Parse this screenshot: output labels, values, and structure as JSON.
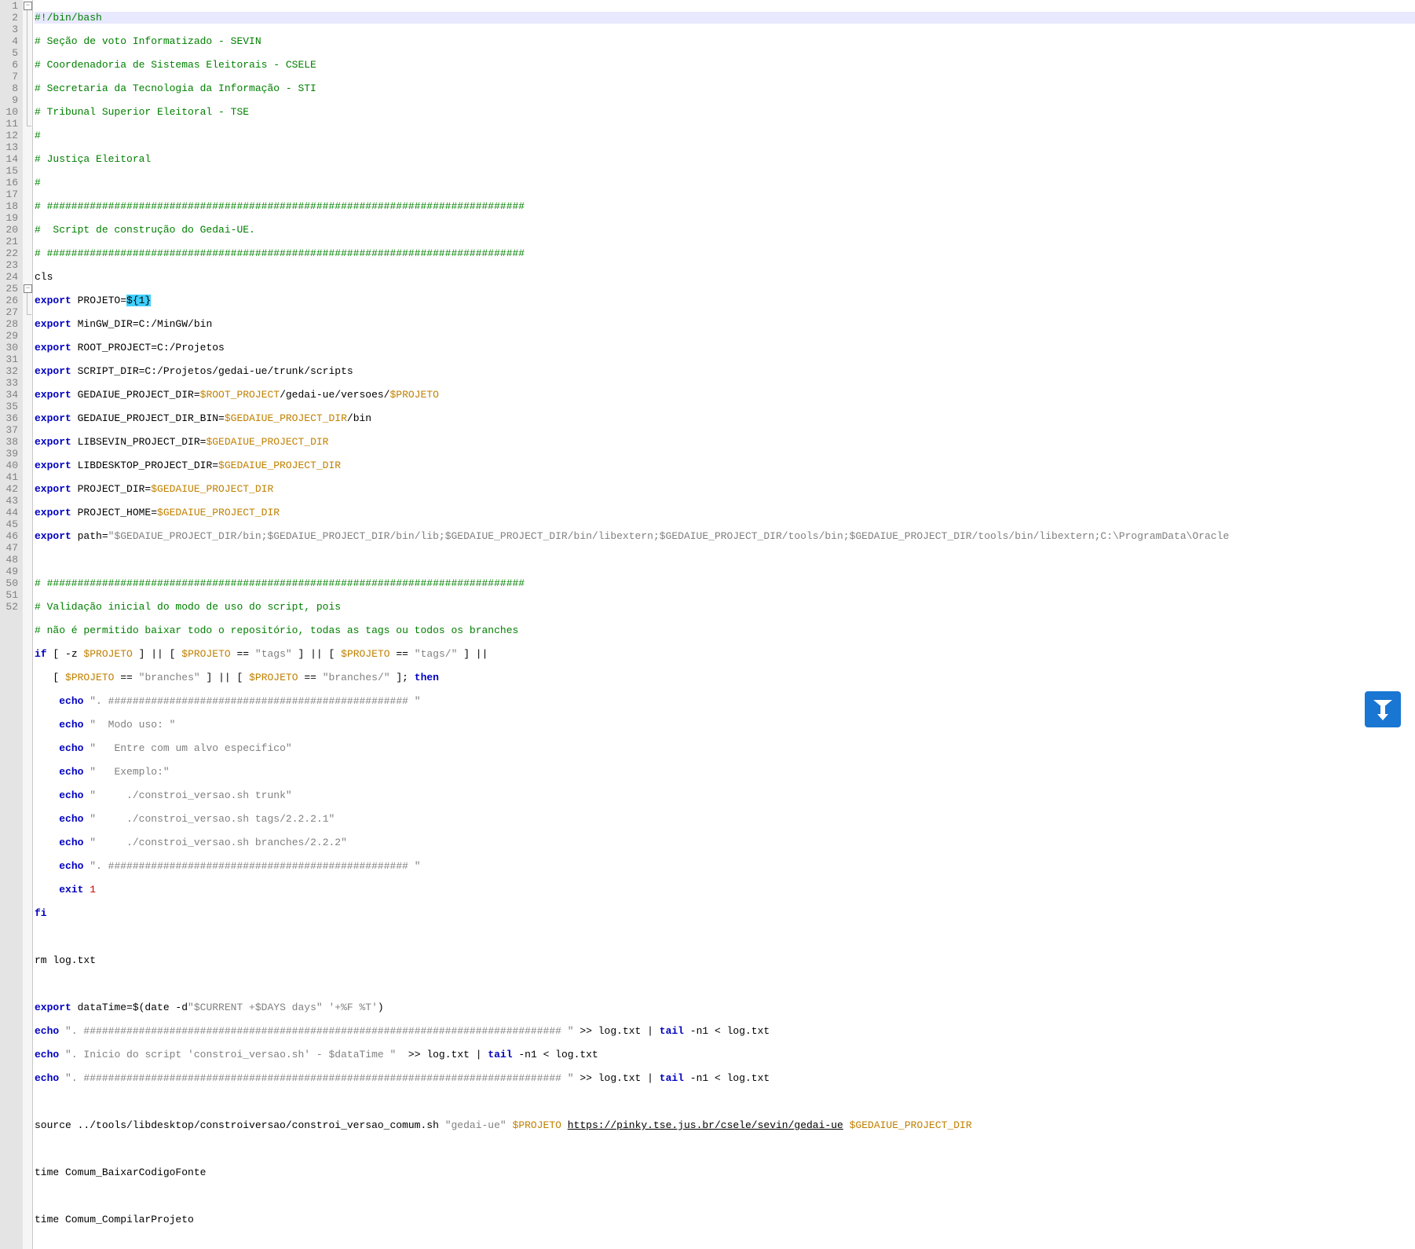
{
  "lines": {
    "n1": "1",
    "n2": "2",
    "n3": "3",
    "n4": "4",
    "n5": "5",
    "n6": "6",
    "n7": "7",
    "n8": "8",
    "n9": "9",
    "n10": "10",
    "n11": "11",
    "n12": "12",
    "n13": "13",
    "n14": "14",
    "n15": "15",
    "n16": "16",
    "n17": "17",
    "n18": "18",
    "n19": "19",
    "n20": "20",
    "n21": "21",
    "n22": "22",
    "n23": "23",
    "n24": "24",
    "n25": "25",
    "n26": "26",
    "n27": "27",
    "n28": "28",
    "n29": "29",
    "n30": "30",
    "n31": "31",
    "n32": "32",
    "n33": "33",
    "n34": "34",
    "n35": "35",
    "n36": "36",
    "n37": "37",
    "n38": "38",
    "n39": "39",
    "n40": "40",
    "n41": "41",
    "n42": "42",
    "n43": "43",
    "n44": "44",
    "n45": "45",
    "n46": "46",
    "n47": "47",
    "n48": "48",
    "n49": "49",
    "n50": "50",
    "n51": "51",
    "n52": "52"
  },
  "c": {
    "shebang": "#!/bin/bash",
    "cm2": "# Seção de voto Informatizado - SEVIN",
    "cm3": "# Coordenadoria de Sistemas Eleitorais - CSELE",
    "cm4": "# Secretaria da Tecnologia da Informação - STI",
    "cm5": "# Tribunal Superior Eleitoral - TSE",
    "cm6": "#",
    "cm7": "# Justiça Eleitoral",
    "cm8": "#",
    "cm9": "# ##############################################################################",
    "cm10": "#  Script de construção do Gedai-UE.",
    "cm11": "# ##############################################################################",
    "l12": "cls",
    "kw_export": "export",
    "l13a": " PROJETO=",
    "l13hl": "${1}",
    "l14": " MinGW_DIR=C:/MinGW/bin",
    "l15": " ROOT_PROJECT=C:/Projetos",
    "l16": " SCRIPT_DIR=C:/Projetos/gedai-ue/trunk/scripts",
    "l17a": " GEDAIUE_PROJECT_DIR=",
    "l17v1": "$ROOT_PROJECT",
    "l17b": "/gedai-ue/versoes/",
    "l17v2": "$PROJETO",
    "l18a": " GEDAIUE_PROJECT_DIR_BIN=",
    "l18v": "$GEDAIUE_PROJECT_DIR",
    "l18b": "/bin",
    "l19a": " LIBSEVIN_PROJECT_DIR=",
    "l20a": " LIBDESKTOP_PROJECT_DIR=",
    "l21a": " PROJECT_DIR=",
    "l22a": " PROJECT_HOME=",
    "l23a": " path=",
    "l23g": "\"$GEDAIUE_PROJECT_DIR/bin;$GEDAIUE_PROJECT_DIR/bin/lib;$GEDAIUE_PROJECT_DIR/bin/libextern;$GEDAIUE_PROJECT_DIR/tools/bin;$GEDAIUE_PROJECT_DIR/tools/bin/libextern;C:\\ProgramData\\Oracle",
    "cm25": "# ##############################################################################",
    "cm26": "# Validação inicial do modo de uso do script, pois",
    "cm27": "# não é permitido baixar todo o repositório, todas as tags ou todos os branches",
    "kw_if": "if",
    "l28a": " [ -z ",
    "l28b": " ] || [ ",
    "l28c": " == ",
    "s_tags": "\"tags\"",
    "l28d": " ] || [ ",
    "s_tags2": "\"tags/\"",
    "l28e": " ] ||",
    "l29a": "   [ ",
    "s_branches": "\"branches\"",
    "l29b": " ] || [ ",
    "s_branches2": "\"branches/\"",
    "l29c": " ]; ",
    "kw_then": "then",
    "kw_echo": "echo",
    "s30": "\". ################################################# \"",
    "s31": "\"  Modo uso: \"",
    "s32": "\"   Entre com um alvo especifico\"",
    "s33": "\"   Exemplo:\"",
    "s34": "\"     ./constroi_versao.sh trunk\"",
    "s35": "\"     ./constroi_versao.sh tags/2.2.2.1\"",
    "s36": "\"     ./constroi_versao.sh branches/2.2.2\"",
    "s37": "\". ################################################# \"",
    "kw_exit": "exit",
    "num1": " 1",
    "kw_fi": "fi",
    "l41": "rm log.txt",
    "l43a": " dataTime=$(date -d",
    "s43": "\"$CURRENT +$DAYS days\" '+%F %T'",
    "l43b": ")",
    "s44": "\". ############################################################################## \"",
    "l44b": " >> log.txt | ",
    "kw_tail": "tail",
    "l44c": " -n1 < log.txt",
    "s45": "\". Inicio do script 'constroi_versao.sh' - $dataTime \"",
    "l45b": "  >> log.txt | ",
    "s46": "\". ############################################################################## \"",
    "l48a": "source ../tools/libdesktop/constroiversao/constroi_versao_comum.sh ",
    "s48": "\"gedai-ue\"",
    "sp": " ",
    "url48": "https://pinky.tse.jus.br/csele/sevin/gedai-ue",
    "l50": "time Comum_BaixarCodigoFonte",
    "l52": "time Comum_CompilarProjeto",
    "pad4": "    ",
    "var_proj": "$PROJETO",
    "var_gedai": "$GEDAIUE_PROJECT_DIR"
  }
}
